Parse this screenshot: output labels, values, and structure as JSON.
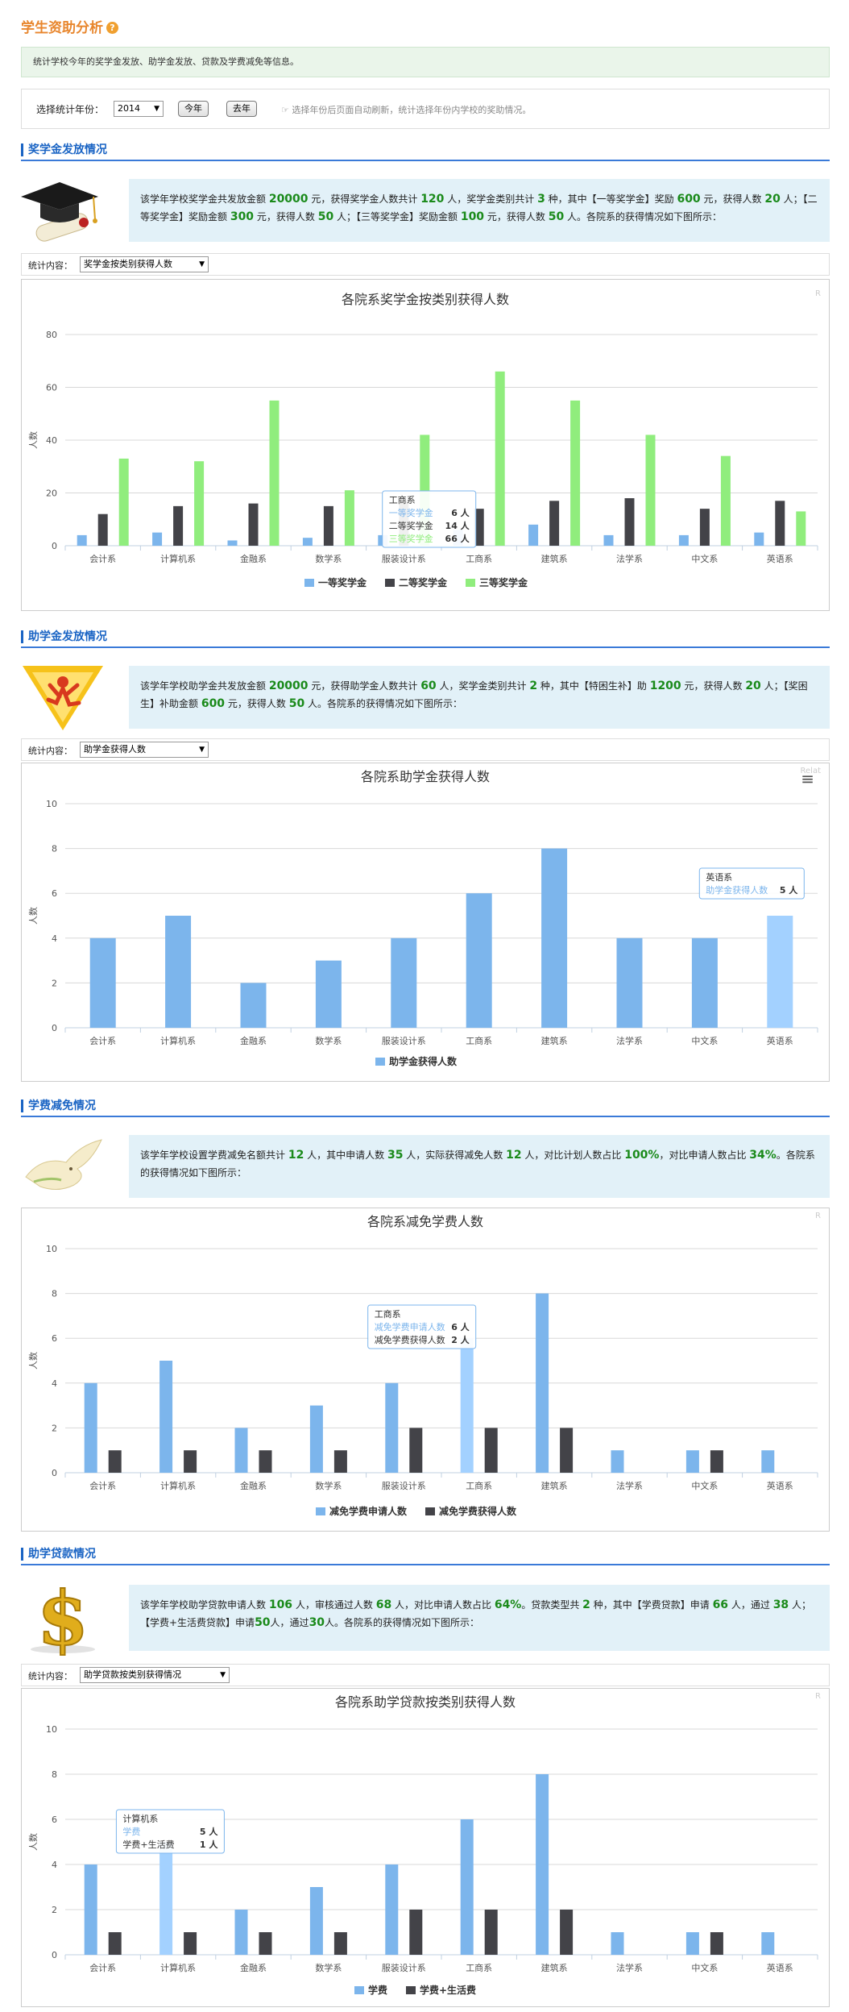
{
  "page": {
    "title": "学生资助分析",
    "help_icon": "?",
    "description": "统计学校今年的奖学金发放、助学金发放、贷款及学费减免等信息。"
  },
  "year_bar": {
    "label": "选择统计年份：",
    "selected_year": "2014",
    "this_year_button": "今年",
    "last_year_button": "去年",
    "hint": "☞ 选择年份后页面自动刷新，统计选择年份内学校的奖助情况。"
  },
  "sections": {
    "scholarship": {
      "title": "奖学金发放情况",
      "icon": "graduation-cap-icon",
      "info_parts": [
        "该学年学校奖学金共发放金额 ",
        "20000",
        " 元，获得奖学金人数共计 ",
        "120",
        " 人，奖学金类别共计 ",
        "3",
        " 种，其中【一等奖学金】奖励 ",
        "600",
        " 元，获得人数 ",
        "20",
        " 人；【二等奖学金】奖励金额 ",
        "300",
        " 元，获得人数 ",
        "50",
        " 人；【三等奖学金】奖励金额 ",
        "100",
        " 元，获得人数 ",
        "50",
        " 人。各院系的获得情况如下图所示："
      ],
      "stat_label": "统计内容：",
      "stat_select": "奖学金按类别获得人数"
    },
    "grant": {
      "title": "助学金发放情况",
      "icon": "runner-icon",
      "info_parts": [
        "该学年学校助学金共发放金额 ",
        "20000",
        " 元，获得助学金人数共计 ",
        "60",
        " 人，奖学金类别共计 ",
        "2",
        " 种，其中【特困生补】助 ",
        "1200",
        " 元，获得人数 ",
        "20",
        " 人；【奖困生】补助金额 ",
        "600",
        " 元，获得人数 ",
        "50",
        " 人。各院系的获得情况如下图所示："
      ],
      "stat_label": "统计内容：",
      "stat_select": "助学金获得人数"
    },
    "tuition": {
      "title": "学费减免情况",
      "icon": "dove-icon",
      "info_parts": [
        "该学年学校设置学费减免名额共计 ",
        "12",
        " 人，其中申请人数 ",
        "35",
        " 人，实际获得减免人数 ",
        "12",
        " 人，对比计划人数占比 ",
        "100%",
        "，对比申请人数占比 ",
        "34%",
        "。各院系的获得情况如下图所示："
      ]
    },
    "loan": {
      "title": "助学贷款情况",
      "icon": "dollar-icon",
      "info_parts": [
        "该学年学校助学贷款申请人数 ",
        "106",
        " 人，审核通过人数 ",
        "68",
        " 人，对比申请人数占比 ",
        "64%",
        "。贷款类型共 ",
        "2",
        " 种，其中【学费贷款】申请 ",
        "66",
        " 人，通过 ",
        "38",
        " 人；【学费+生活费贷款】申请",
        "50",
        "人，通过",
        "30",
        "人。各院系的获得情况如下图所示："
      ],
      "stat_label": "统计内容：",
      "stat_select": "助学贷款按类别获得情况"
    }
  },
  "colors": {
    "blue": "#7cb5ec",
    "dark": "#434348",
    "green": "#90ed7d",
    "highlight": "#a3d1ff"
  },
  "chart_data": [
    {
      "type": "bar",
      "title": "各院系奖学金按类别获得人数",
      "ylabel": "人数",
      "ylim": [
        0,
        80
      ],
      "yticks": [
        0,
        20,
        40,
        60,
        80
      ],
      "categories": [
        "会计系",
        "计算机系",
        "金融系",
        "数学系",
        "服装设计系",
        "工商系",
        "建筑系",
        "法学系",
        "中文系",
        "英语系"
      ],
      "series": [
        {
          "name": "一等奖学金",
          "color": "#7cb5ec",
          "values": [
            4,
            5,
            2,
            3,
            4,
            6,
            8,
            4,
            4,
            5
          ]
        },
        {
          "name": "二等奖学金",
          "color": "#434348",
          "values": [
            12,
            15,
            16,
            15,
            17,
            14,
            17,
            18,
            14,
            17
          ]
        },
        {
          "name": "三等奖学金",
          "color": "#90ed7d",
          "values": [
            33,
            32,
            55,
            21,
            42,
            66,
            55,
            42,
            34,
            13
          ]
        }
      ],
      "tooltip": {
        "category": "工商系",
        "rows": [
          [
            "一等奖学金",
            "6 人"
          ],
          [
            "二等奖学金",
            "14 人"
          ],
          [
            "三等奖学金",
            "66 人"
          ]
        ]
      },
      "corner_mark": "R"
    },
    {
      "type": "bar",
      "title": "各院系助学金获得人数",
      "ylabel": "人数",
      "ylim": [
        0,
        10
      ],
      "yticks": [
        0,
        2,
        4,
        6,
        8,
        10
      ],
      "categories": [
        "会计系",
        "计算机系",
        "金融系",
        "数学系",
        "服装设计系",
        "工商系",
        "建筑系",
        "法学系",
        "中文系",
        "英语系"
      ],
      "series": [
        {
          "name": "助学金获得人数",
          "color": "#7cb5ec",
          "values": [
            4,
            5,
            2,
            3,
            4,
            6,
            8,
            4,
            4,
            5
          ]
        }
      ],
      "highlight_index": 9,
      "tooltip": {
        "category": "英语系",
        "rows": [
          [
            "助学金获得人数",
            "5 人"
          ]
        ]
      },
      "corner_mark": "Relat",
      "menu_icon": "≡"
    },
    {
      "type": "bar",
      "title": "各院系减免学费人数",
      "ylabel": "人数",
      "ylim": [
        0,
        10
      ],
      "yticks": [
        0,
        2,
        4,
        6,
        8,
        10
      ],
      "categories": [
        "会计系",
        "计算机系",
        "金融系",
        "数学系",
        "服装设计系",
        "工商系",
        "建筑系",
        "法学系",
        "中文系",
        "英语系"
      ],
      "series": [
        {
          "name": "减免学费申请人数",
          "color": "#7cb5ec",
          "values": [
            4,
            5,
            2,
            3,
            4,
            6,
            8,
            1,
            1,
            1
          ]
        },
        {
          "name": "减免学费获得人数",
          "color": "#434348",
          "values": [
            1,
            1,
            1,
            1,
            2,
            2,
            2,
            0,
            1,
            0
          ]
        }
      ],
      "highlight_index": 5,
      "tooltip": {
        "category": "工商系",
        "rows": [
          [
            "减免学费申请人数",
            "6 人"
          ],
          [
            "减免学费获得人数",
            "2 人"
          ]
        ]
      },
      "corner_mark": "R"
    },
    {
      "type": "bar",
      "title": "各院系助学贷款按类别获得人数",
      "ylabel": "人数",
      "ylim": [
        0,
        10
      ],
      "yticks": [
        0,
        2,
        4,
        6,
        8,
        10
      ],
      "categories": [
        "会计系",
        "计算机系",
        "金融系",
        "数学系",
        "服装设计系",
        "工商系",
        "建筑系",
        "法学系",
        "中文系",
        "英语系"
      ],
      "series": [
        {
          "name": "学费",
          "color": "#7cb5ec",
          "values": [
            4,
            5,
            2,
            3,
            4,
            6,
            8,
            1,
            1,
            1
          ]
        },
        {
          "name": "学费+生活费",
          "color": "#434348",
          "values": [
            1,
            1,
            1,
            1,
            2,
            2,
            2,
            0,
            1,
            0
          ]
        }
      ],
      "highlight_index": 1,
      "tooltip": {
        "category": "计算机系",
        "rows": [
          [
            "学费",
            "5 人"
          ],
          [
            "学费+生活费",
            "1 人"
          ]
        ]
      },
      "corner_mark": "R"
    }
  ]
}
